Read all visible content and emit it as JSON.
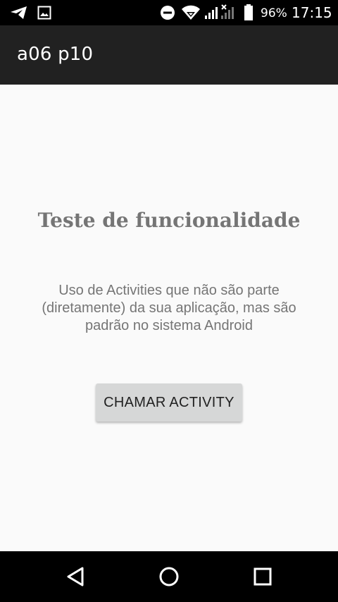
{
  "status_bar": {
    "battery_percent": "96%",
    "time": "17:15",
    "icons": [
      "telegram-icon",
      "image-icon",
      "do-not-disturb-icon",
      "wifi-icon",
      "signal-icon",
      "signal-no-data-icon",
      "battery-icon"
    ]
  },
  "toolbar": {
    "title": "a06 p10"
  },
  "main": {
    "heading": "Teste de funcionalidade",
    "description": "Uso de Activities que não são parte (diretamente) da sua aplicação, mas são padrão no sistema Android",
    "button_label": "CHAMAR ACTIVITY"
  },
  "nav_bar": {
    "icons": [
      "back-icon",
      "home-icon",
      "recents-icon"
    ]
  },
  "colors": {
    "toolbar_bg": "#212121",
    "content_bg": "#fafafa",
    "text_gray": "#757575",
    "button_bg": "#d6d7d7"
  }
}
